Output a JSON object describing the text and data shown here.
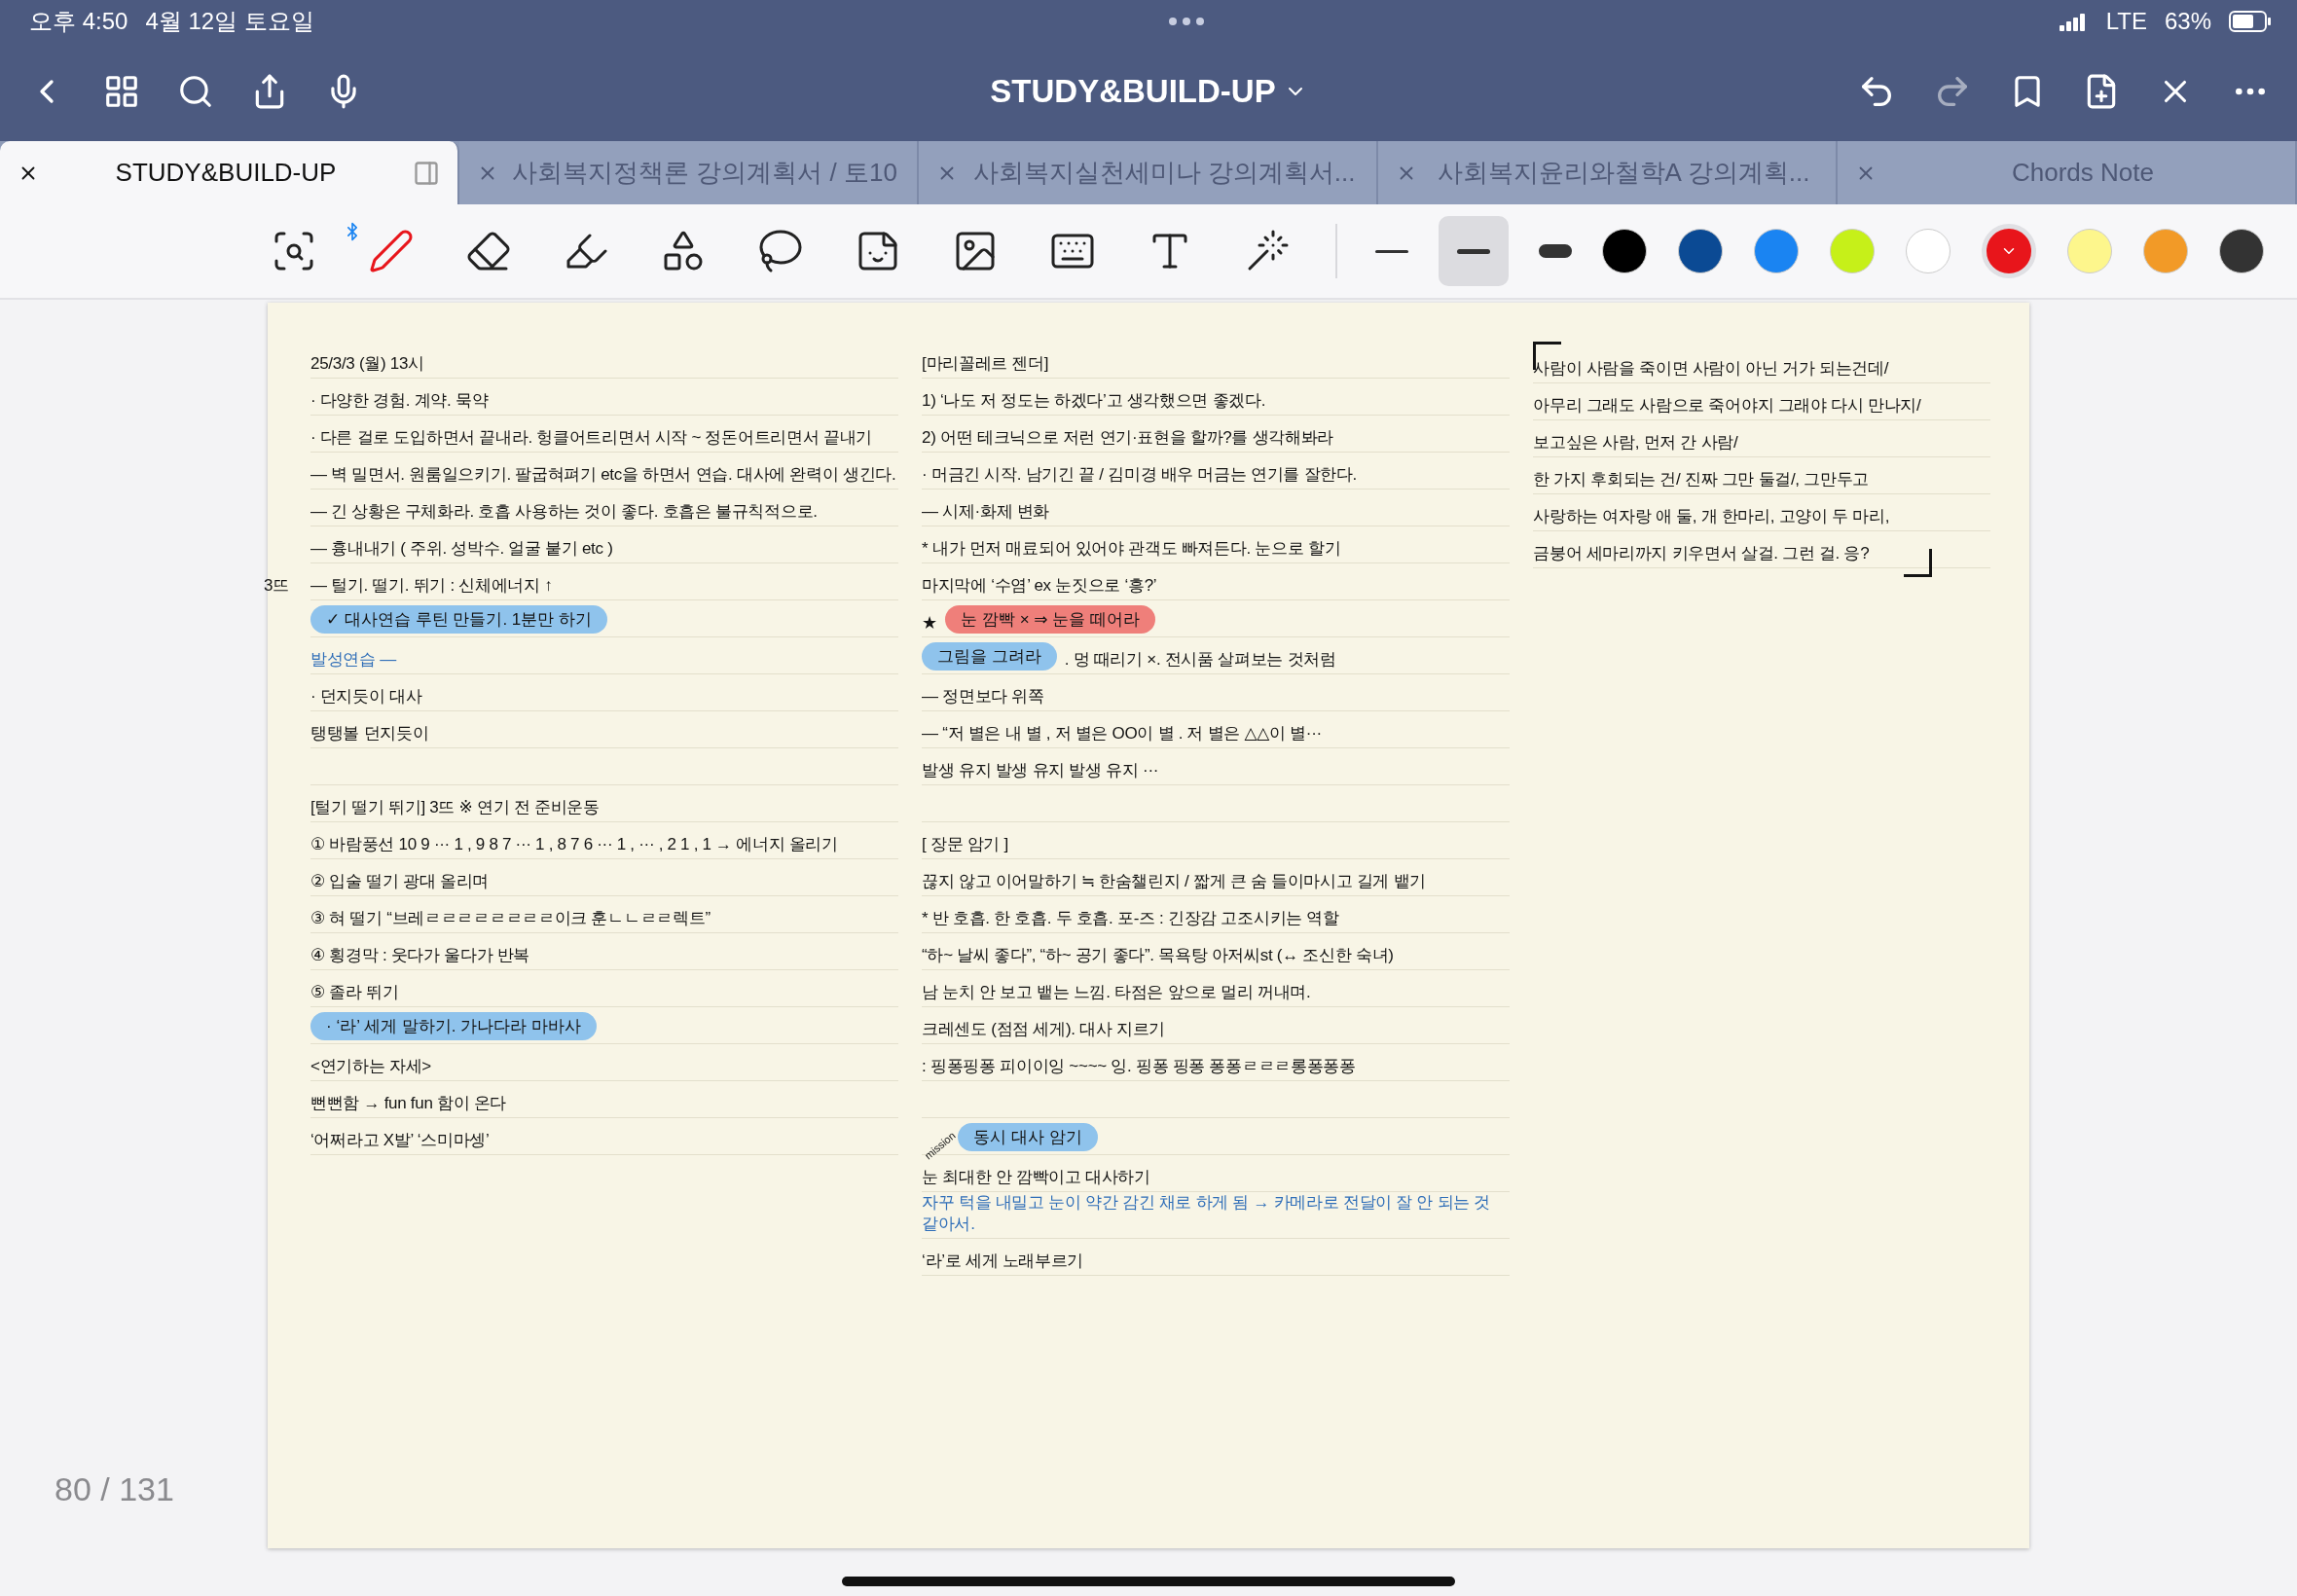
{
  "status_bar": {
    "time": "오후 4:50",
    "date": "4월 12일 토요일",
    "network": "LTE",
    "battery": "63%"
  },
  "nav": {
    "title": "STUDY&BUILD-UP"
  },
  "tabs": [
    {
      "label": "STUDY&BUILD-UP",
      "selected": true
    },
    {
      "label": "사회복지정책론 강의계획서 / 토10",
      "selected": false
    },
    {
      "label": "사회복지실천세미나 강의계획서...",
      "selected": false
    },
    {
      "label": "사회복지윤리와철학A 강의계획...",
      "selected": false
    },
    {
      "label": "Chords Note",
      "selected": false
    }
  ],
  "tools": [
    {
      "kind": "zoom",
      "selected": false
    },
    {
      "kind": "pen",
      "selected": true
    },
    {
      "kind": "eraser",
      "selected": false
    },
    {
      "kind": "highlighter",
      "selected": false
    },
    {
      "kind": "shapes",
      "selected": false
    },
    {
      "kind": "lasso",
      "selected": false
    },
    {
      "kind": "sticker",
      "selected": false
    },
    {
      "kind": "image",
      "selected": false
    },
    {
      "kind": "keyboard",
      "selected": false
    },
    {
      "kind": "text",
      "selected": false
    },
    {
      "kind": "laser",
      "selected": false
    }
  ],
  "stroke_sizes": [
    {
      "kind": "thin",
      "selected": false
    },
    {
      "kind": "medium",
      "selected": true
    },
    {
      "kind": "thick",
      "selected": false
    }
  ],
  "colors": [
    {
      "color": "#000000",
      "selected": false
    },
    {
      "color": "#0b4a94",
      "selected": false
    },
    {
      "color": "#1a84f2",
      "selected": false
    },
    {
      "color": "#c6f019",
      "selected": false
    },
    {
      "color": "#ffffff",
      "selected": false
    },
    {
      "color": "#e8151b",
      "selected": true
    },
    {
      "color": "#fdf68c",
      "selected": false
    },
    {
      "color": "#f29a27",
      "selected": false
    },
    {
      "color": "#333333",
      "selected": false
    }
  ],
  "page": {
    "columns": [
      [
        {
          "kind": "line",
          "text": "25/3/3 (월) 13시"
        },
        {
          "kind": "line",
          "text": "· 다양한 경험. 계약. 묵약"
        },
        {
          "kind": "line",
          "text": "· 다른 걸로 도입하면서 끝내라. 헝클어트리면서 시작 ~ 정돈어트리면서 끝내기"
        },
        {
          "kind": "line",
          "text": "— 벽 밀면서. 원룸일으키기. 팔굽혀펴기 etc을 하면서 연습. 대사에 완력이 생긴다."
        },
        {
          "kind": "line",
          "text": "— 긴 상황은 구체화라. 호흡 사용하는 것이 좋다. 호흡은 불규칙적으로."
        },
        {
          "kind": "line",
          "text": "— 흉내내기 ( 주위. 성박수. 얼굴 붙기 etc )"
        },
        {
          "kind": "line",
          "text": "— 털기. 떨기. 뛰기 : 신체에너지 ↑",
          "margin": "3뜨"
        },
        {
          "kind": "highlight",
          "text": "✓ 대사연습 루틴 만들기. 1분만 하기",
          "color": "#8fc3ec"
        },
        {
          "kind": "note",
          "text": "발성연습 —"
        },
        {
          "kind": "line",
          "text": "· 던지듯이 대사"
        },
        {
          "kind": "line",
          "text": "탱탱볼 던지듯이"
        },
        {
          "kind": "gap"
        },
        {
          "kind": "line",
          "text": "[털기  떨기  뛰기] 3뜨 ※ 연기 전 준비운동"
        },
        {
          "kind": "line",
          "text": "① 바람풍선  10 9 ··· 1 , 9 8 7 ··· 1 , 8 7 6 ··· 1 , ··· , 2 1 , 1 → 에너지 올리기"
        },
        {
          "kind": "line",
          "text": "② 입술 떨기 광대 올리며"
        },
        {
          "kind": "line",
          "text": "③ 혀 떨기 “브레ㄹㄹㄹㄹㄹㄹㄹㄹ이크 훈ㄴㄴㄹㄹ렉트”"
        },
        {
          "kind": "line",
          "text": "④ 횡경막 : 웃다가 울다가 반복"
        },
        {
          "kind": "line",
          "text": "⑤ 졸라 뛰기"
        },
        {
          "kind": "highlight",
          "text": "· ‘라’ 세게 말하기. 가나다라 마바사",
          "color": "#8fc3ec"
        },
        {
          "kind": "line",
          "text": "<연기하는 자세>"
        },
        {
          "kind": "line",
          "text": "뻔뻔함 → fun fun 함이 온다"
        },
        {
          "kind": "line",
          "text": "‘어쩌라고 X발’ ‘스미마셍’"
        }
      ],
      [
        {
          "kind": "line",
          "text": "[마리꼴레르 젠더]"
        },
        {
          "kind": "line",
          "text": "1) ‘나도 저 정도는 하겠다’고 생각했으면 좋겠다."
        },
        {
          "kind": "line",
          "text": "2) 어떤 테크닉으로 저런 연기·표현을 할까?를 생각해봐라"
        },
        {
          "kind": "line",
          "text": "· 머금긴 시작. 남기긴 끝  /  김미경 배우 머금는 연기를 잘한다."
        },
        {
          "kind": "line",
          "text": "— 시제·화제 변화"
        },
        {
          "kind": "line",
          "text": "* 내가 먼저 매료되어 있어야 관객도 빠져든다. 눈으로 할기"
        },
        {
          "kind": "line",
          "text": "마지막에 ‘수염’  ex 눈짓으로 ‘흥?’"
        },
        {
          "kind": "highlight",
          "prefix": "★",
          "text": "눈 깜빡 × ⇒ 눈을 떼어라",
          "color": "#ef7f7a"
        },
        {
          "kind": "highlight",
          "text": "그림을 그려라",
          "after": ". 멍 때리기 ×. 전시품 살펴보는 것처럼",
          "color": "#8fc3ec"
        },
        {
          "kind": "line",
          "text": "— 정면보다  위쪽"
        },
        {
          "kind": "line",
          "text": "— “저 별은 내 별 ,  저 별은  OO이 별 .  저  별은  △△이 별···"
        },
        {
          "kind": "line",
          "text": "발생   유지   발생   유지   발생   유지 ···"
        },
        {
          "kind": "gap"
        },
        {
          "kind": "line",
          "text": "[ 장문 암기 ]"
        },
        {
          "kind": "line",
          "text": "끊지 않고  이어말하기 ≒ 한숨챌린지 / 짧게 큰 숨 들이마시고 길게 뱉기"
        },
        {
          "kind": "line",
          "text": "* 반 호흡. 한 호흡. 두 호흡. 포-즈 : 긴장감 고조시키는 역할"
        },
        {
          "kind": "line",
          "text": "“하~ 날씨 좋다”, “하~ 공기 좋다”. 목욕탕 아저씨st (↔ 조신한 숙녀)"
        },
        {
          "kind": "line",
          "text": "남 눈치 안 보고 뱉는 느낌. 타점은 앞으로 멀리 꺼내며."
        },
        {
          "kind": "line",
          "text": "크레센도 (점점 세게). 대사 지르기"
        },
        {
          "kind": "line",
          "text": ": 핑퐁핑퐁 피이이잉 ~~~~ 잉. 핑퐁 핑퐁 퐁퐁ㄹㄹㄹ롱퐁퐁퐁"
        },
        {
          "kind": "gap"
        },
        {
          "kind": "highlight",
          "label": "mission",
          "text": "동시 대사 암기",
          "color": "#8fc3ec"
        },
        {
          "kind": "line",
          "text": "눈 최대한 안 깜빡이고 대사하기"
        },
        {
          "kind": "note",
          "text": "자꾸 턱을 내밀고 눈이 약간 감긴 채로 하게 됨 → 카메라로 전달이 잘 안 되는 것 같아서."
        },
        {
          "kind": "line",
          "text": "‘라’로 세게 노래부르기"
        }
      ],
      [
        {
          "kind": "line",
          "text": "사람이 사람을 죽이면 사람이 아닌 거가 되는건데/"
        },
        {
          "kind": "line",
          "text": "아무리 그래도 사람으로 죽어야지 그래야 다시 만나지/"
        },
        {
          "kind": "line",
          "text": "보고싶은 사람, 먼저 간 사람/"
        },
        {
          "kind": "line",
          "text": "한 가지 후회되는 건/ 진짜  그만 둘걸/, 그만두고"
        },
        {
          "kind": "line",
          "text": "사랑하는 여자랑 애 둘,   개 한마리, 고양이 두 마리,"
        },
        {
          "kind": "line",
          "text": "금붕어 세마리까지 키우면서 살걸. 그런 걸. 응?"
        }
      ]
    ]
  },
  "page_counter": "80 / 131"
}
